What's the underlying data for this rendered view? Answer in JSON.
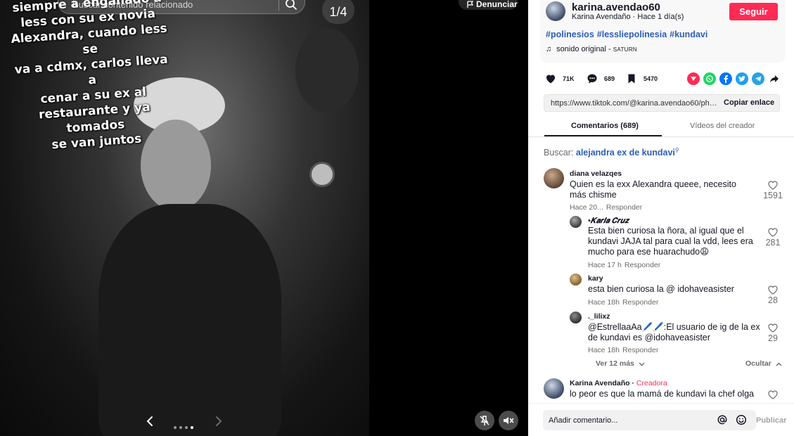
{
  "viewer": {
    "search_placeholder": "Buscar contenido relacionado",
    "page_counter": "1/4",
    "report_label": "Denunciar",
    "overlay_lines": [
      "siempre a engañado a",
      "less con su ex novia",
      "Alexandra, cuando less se",
      "va a cdmx, carlos lleva a",
      "cenar a su ex al",
      "restaurante y ya tomados",
      "se van juntos"
    ],
    "carousel": {
      "total": 4,
      "current": 4
    }
  },
  "post": {
    "username": "karina.avendao60",
    "display_name": "Karina Avendaño",
    "time_ago": "Hace 1 día(s)",
    "follow_label": "Seguir",
    "hashtags": [
      "#polinesios",
      "#lessliepolinesia",
      "#kundavi"
    ],
    "sound_label": "sonido original -",
    "sound_artist": "SATURN",
    "likes": "71K",
    "comments": "689",
    "saves": "5470",
    "link_url": "https://www.tiktok.com/@karina.avendao60/photo/",
    "copy_link_label": "Copiar enlace"
  },
  "tabs": {
    "comments": "Comentarios (689)",
    "creator_videos": "Vídeos del creador"
  },
  "search_suggest": {
    "prefix": "Buscar:",
    "term": "alejandra ex de kundavi"
  },
  "comments": [
    {
      "name": "diana velazqes",
      "text": "Quien es la exx Alexandra queee, necesito más chisme",
      "time": "Hace 20...",
      "reply": "Responder",
      "likes": "1591"
    }
  ],
  "replies": [
    {
      "name": "•𝑲𝒂𝒓𝒍𝒂 𝑪𝒓𝒖𝒛",
      "text": "Esta bien curiosa la ñora, al igual que el kundavi JAJA tal para cual la vdd, lees era mucho para ese huarachudo😩",
      "time": "Hace 17 h",
      "reply": "Responder",
      "likes": "281"
    },
    {
      "name": "kary",
      "text": "esta bien curiosa la @ idohaveasister",
      "time": "Hace 18h",
      "reply": "Responder",
      "likes": "28"
    },
    {
      "name": "._lilixz",
      "text": "@EstrellaaAa🖊️🖊️:El usuario de ig de la ex de kundavi es @idohaveasister",
      "time": "Hace 18h",
      "reply": "Responder",
      "likes": "29"
    }
  ],
  "view_more_label": "Ver 12 más",
  "hide_label": "Ocultar",
  "creator_comment": {
    "name": "Karina Avendaño",
    "separator": " · ",
    "tag": "Creadora",
    "text": "lo peor es que la mamá de kundavi la chef olga"
  },
  "composer": {
    "placeholder": "Añadir comentario...",
    "post_label": "Publicar"
  },
  "colors": {
    "accent": "#fe2c55",
    "link": "#2b5db9",
    "share_red": "#fe2c55",
    "share_whatsapp": "#25d366",
    "share_facebook": "#0075fa",
    "share_twitter": "#1da1f2",
    "share_telegram": "#2aa3df"
  },
  "icons": {
    "search": "search-icon",
    "flag": "flag-icon",
    "chevron_left": "chevron-left-icon",
    "chevron_right": "chevron-right-icon",
    "pin": "pin-off-icon",
    "mute": "speaker-muted-icon",
    "heart": "heart-icon",
    "comment": "comment-bubble-icon",
    "bookmark": "bookmark-icon",
    "share": "share-arrow-icon"
  }
}
